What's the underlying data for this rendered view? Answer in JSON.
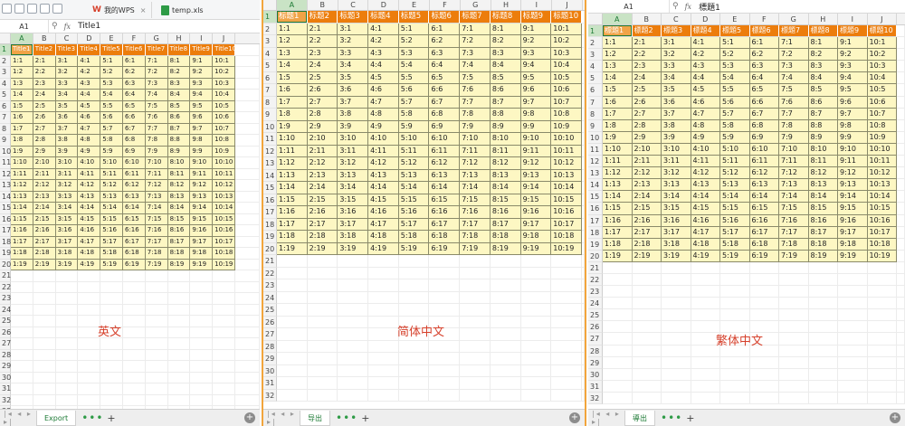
{
  "window1": {
    "wps_tab_label": "我的WPS",
    "file_tab_label": "temp.xls",
    "close_glyph": "×",
    "name_box": "A1",
    "formula_value": "Title1",
    "sheet_tab": "Export",
    "caption": "英文",
    "header_row": [
      "Title1",
      "Title2",
      "Title3",
      "Title4",
      "Title5",
      "Title6",
      "Title7",
      "Title8",
      "Title9",
      "Title10"
    ]
  },
  "window2": {
    "sheet_tab": "导出",
    "caption": "简体中文",
    "header_row": [
      "标题1",
      "标题2",
      "标题3",
      "标题4",
      "标题5",
      "标题6",
      "标题7",
      "标题8",
      "标题9",
      "标题10"
    ]
  },
  "window3": {
    "name_box": "A1",
    "formula_value": "標題1",
    "sheet_tab": "導出",
    "caption": "繁体中文",
    "header_row": [
      "標題1",
      "標題2",
      "標題3",
      "標題4",
      "標題5",
      "標題6",
      "標題7",
      "標題8",
      "標題9",
      "標題10"
    ]
  },
  "ui": {
    "fx_label": "fx",
    "zoom_glyph": "⚲",
    "nav_glyphs": "|◂ ◂ ▸ ▸|",
    "dots": "•••",
    "plus": "+",
    "add_sheet": "+"
  },
  "column_letters": [
    "A",
    "B",
    "C",
    "D",
    "E",
    "F",
    "G",
    "H",
    "I",
    "J"
  ],
  "data_rows": [
    [
      "1:1",
      "2:1",
      "3:1",
      "4:1",
      "5:1",
      "6:1",
      "7:1",
      "8:1",
      "9:1",
      "10:1"
    ],
    [
      "1:2",
      "2:2",
      "3:2",
      "4:2",
      "5:2",
      "6:2",
      "7:2",
      "8:2",
      "9:2",
      "10:2"
    ],
    [
      "1:3",
      "2:3",
      "3:3",
      "4:3",
      "5:3",
      "6:3",
      "7:3",
      "8:3",
      "9:3",
      "10:3"
    ],
    [
      "1:4",
      "2:4",
      "3:4",
      "4:4",
      "5:4",
      "6:4",
      "7:4",
      "8:4",
      "9:4",
      "10:4"
    ],
    [
      "1:5",
      "2:5",
      "3:5",
      "4:5",
      "5:5",
      "6:5",
      "7:5",
      "8:5",
      "9:5",
      "10:5"
    ],
    [
      "1:6",
      "2:6",
      "3:6",
      "4:6",
      "5:6",
      "6:6",
      "7:6",
      "8:6",
      "9:6",
      "10:6"
    ],
    [
      "1:7",
      "2:7",
      "3:7",
      "4:7",
      "5:7",
      "6:7",
      "7:7",
      "8:7",
      "9:7",
      "10:7"
    ],
    [
      "1:8",
      "2:8",
      "3:8",
      "4:8",
      "5:8",
      "6:8",
      "7:8",
      "8:8",
      "9:8",
      "10:8"
    ],
    [
      "1:9",
      "2:9",
      "3:9",
      "4:9",
      "5:9",
      "6:9",
      "7:9",
      "8:9",
      "9:9",
      "10:9"
    ],
    [
      "1:10",
      "2:10",
      "3:10",
      "4:10",
      "5:10",
      "6:10",
      "7:10",
      "8:10",
      "9:10",
      "10:10"
    ],
    [
      "1:11",
      "2:11",
      "3:11",
      "4:11",
      "5:11",
      "6:11",
      "7:11",
      "8:11",
      "9:11",
      "10:11"
    ],
    [
      "1:12",
      "2:12",
      "3:12",
      "4:12",
      "5:12",
      "6:12",
      "7:12",
      "8:12",
      "9:12",
      "10:12"
    ],
    [
      "1:13",
      "2:13",
      "3:13",
      "4:13",
      "5:13",
      "6:13",
      "7:13",
      "8:13",
      "9:13",
      "10:13"
    ],
    [
      "1:14",
      "2:14",
      "3:14",
      "4:14",
      "5:14",
      "6:14",
      "7:14",
      "8:14",
      "9:14",
      "10:14"
    ],
    [
      "1:15",
      "2:15",
      "3:15",
      "4:15",
      "5:15",
      "6:15",
      "7:15",
      "8:15",
      "9:15",
      "10:15"
    ],
    [
      "1:16",
      "2:16",
      "3:16",
      "4:16",
      "5:16",
      "6:16",
      "7:16",
      "8:16",
      "9:16",
      "10:16"
    ],
    [
      "1:17",
      "2:17",
      "3:17",
      "4:17",
      "5:17",
      "6:17",
      "7:17",
      "8:17",
      "9:17",
      "10:17"
    ],
    [
      "1:18",
      "2:18",
      "3:18",
      "4:18",
      "5:18",
      "6:18",
      "7:18",
      "8:18",
      "9:18",
      "10:18"
    ],
    [
      "1:19",
      "2:19",
      "3:19",
      "4:19",
      "5:19",
      "6:19",
      "7:19",
      "8:19",
      "9:19",
      "10:19"
    ]
  ],
  "rows1_count": 33,
  "rows2_count": 32,
  "rows3_count": 32
}
